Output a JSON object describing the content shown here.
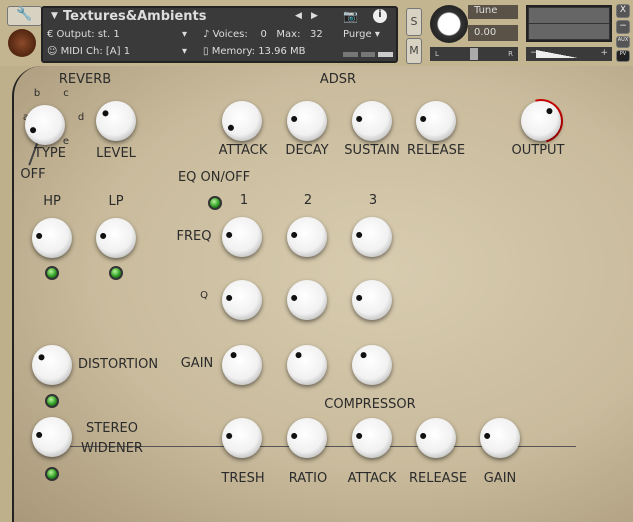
{
  "header": {
    "title": "Textures&Ambients",
    "output_label": "Output:",
    "output_value": "st. 1",
    "voices_label": "Voices:",
    "voices_value": "0",
    "max_label": "Max:",
    "max_value": "32",
    "midi_label": "MIDI Ch:",
    "midi_value": "[A]  1",
    "memory_label": "Memory:",
    "memory_value": "13.96 MB",
    "purge": "Purge",
    "solo": "S",
    "mute": "M",
    "tune_label": "Tune",
    "tune_value": "0.00",
    "pan_left": "L",
    "pan_right": "R",
    "vol_minus": "−",
    "vol_plus": "+",
    "close": "X",
    "minimize": "−",
    "aux": "AUX",
    "pv": "PV"
  },
  "labels": {
    "reverb": "REVERB",
    "adsr": "ADSR",
    "type": "TYPE",
    "off": "OFF",
    "level": "LEVEL",
    "a": "a",
    "b": "b",
    "c": "c",
    "d": "d",
    "e": "e",
    "attack": "ATTACK",
    "decay": "DECAY",
    "sustain": "SUSTAIN",
    "release": "RELEASE",
    "output": "OUTPUT",
    "eq_onoff": "EQ ON/OFF",
    "band1": "1",
    "band2": "2",
    "band3": "3",
    "hp": "HP",
    "lp": "LP",
    "freq": "FREQ",
    "q": "Q",
    "gain": "GAIN",
    "distortion": "DISTORTION",
    "stereo": "STEREO",
    "widener": "WIDENER",
    "compressor": "COMPRESSOR",
    "tresh": "TRESH",
    "ratio": "RATIO",
    "c_attack": "ATTACK",
    "c_release": "RELEASE",
    "c_gain": "GAIN"
  },
  "knobs": {
    "type": 0.08,
    "level": 0.3,
    "attack": 0.05,
    "decay": 0.2,
    "sustain": 0.2,
    "release": 0.2,
    "output": 0.65,
    "hp": 0.2,
    "lp": 0.2,
    "freq1": 0.2,
    "freq2": 0.2,
    "freq3": 0.2,
    "q1": 0.2,
    "q2": 0.2,
    "q3": 0.2,
    "gain1": 0.35,
    "gain2": 0.35,
    "gain3": 0.35,
    "distortion": 0.3,
    "stereo": 0.2,
    "tresh": 0.2,
    "ratio": 0.2,
    "c_attack": 0.2,
    "c_release": 0.2,
    "c_gain": 0.2
  }
}
